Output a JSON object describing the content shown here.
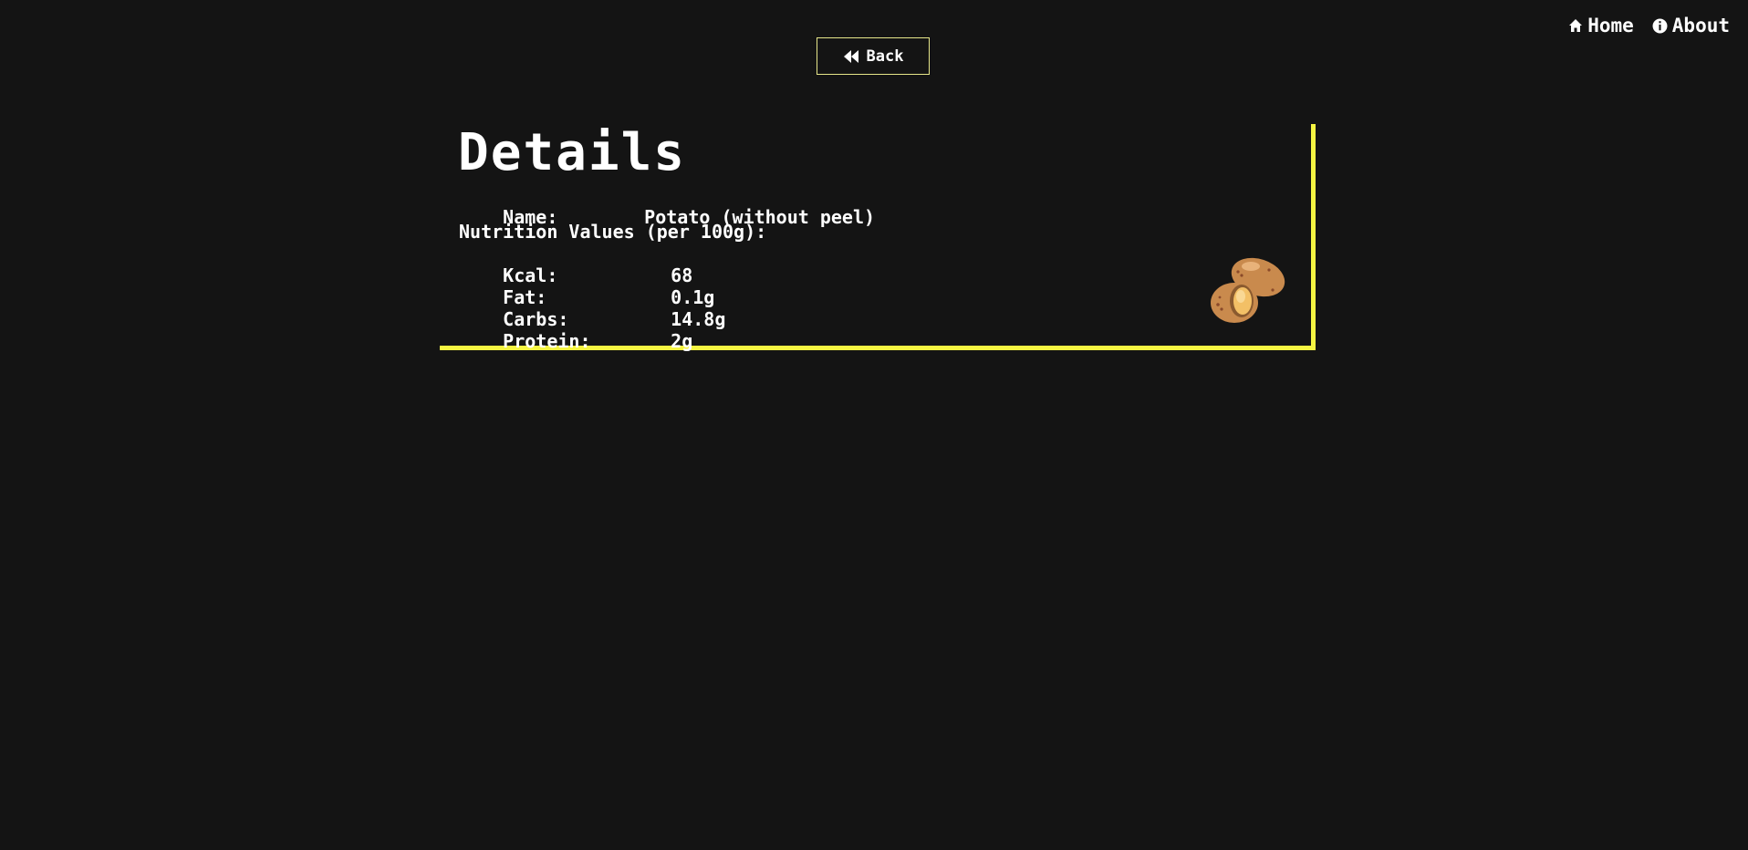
{
  "nav": {
    "home_label": "Home",
    "about_label": "About"
  },
  "back_button": {
    "label": "Back"
  },
  "details": {
    "title": "Details",
    "name_label": "Name:",
    "name_value": "Potato (without peel)",
    "nutrition_heading": "Nutrition Values (per 100g):",
    "nutrition": [
      {
        "label": "Kcal:",
        "value": "68"
      },
      {
        "label": "Fat:",
        "value": "0.1g"
      },
      {
        "label": "Carbs:",
        "value": "14.8g"
      },
      {
        "label": "Protein:",
        "value": "2g"
      }
    ]
  },
  "colors": {
    "background": "#141414",
    "accent": "#f5f542",
    "button_border": "#e6e68a",
    "text": "#ffffff"
  },
  "icons": {
    "home": "home-icon",
    "about": "info-icon",
    "back": "rewind-icon",
    "food": "potato-icon"
  }
}
